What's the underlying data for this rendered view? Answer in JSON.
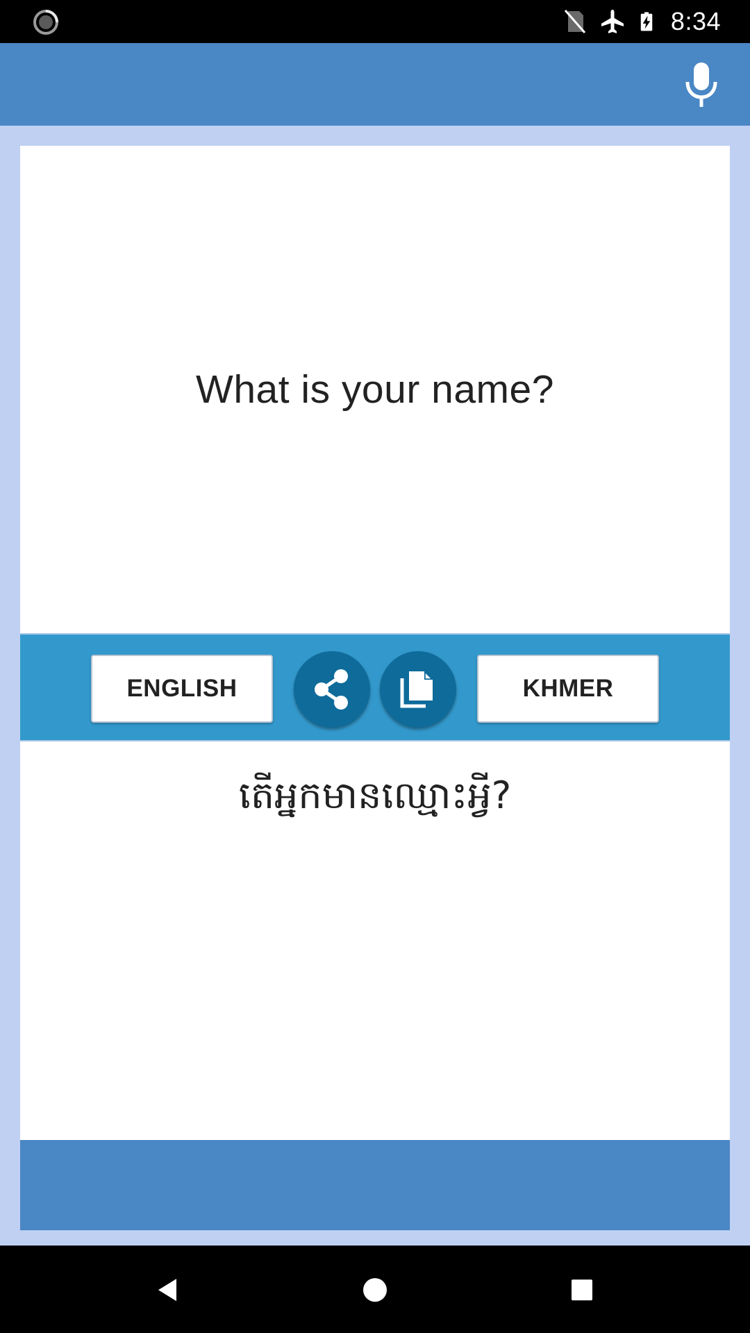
{
  "status_bar": {
    "time": "8:34",
    "icons": [
      "loading-icon",
      "no-sim-icon",
      "airplane-icon",
      "battery-charging-icon"
    ]
  },
  "app_bar": {
    "mic_icon": "mic-icon"
  },
  "translation": {
    "source_text": "What is your name?",
    "target_text": "តើអ្នកមានឈ្មោះអ្វី?"
  },
  "toolbar": {
    "source_language": "ENGLISH",
    "target_language": "KHMER",
    "share_icon": "share-icon",
    "copy_icon": "copy-icon"
  },
  "navigation": {
    "back_icon": "back-icon",
    "home_icon": "home-icon",
    "recents_icon": "recents-icon"
  },
  "colors": {
    "app_bar": "#4a87c5",
    "toolbar": "#3399cc",
    "round_button": "#0e6b9a",
    "background": "#c0d0f2"
  }
}
